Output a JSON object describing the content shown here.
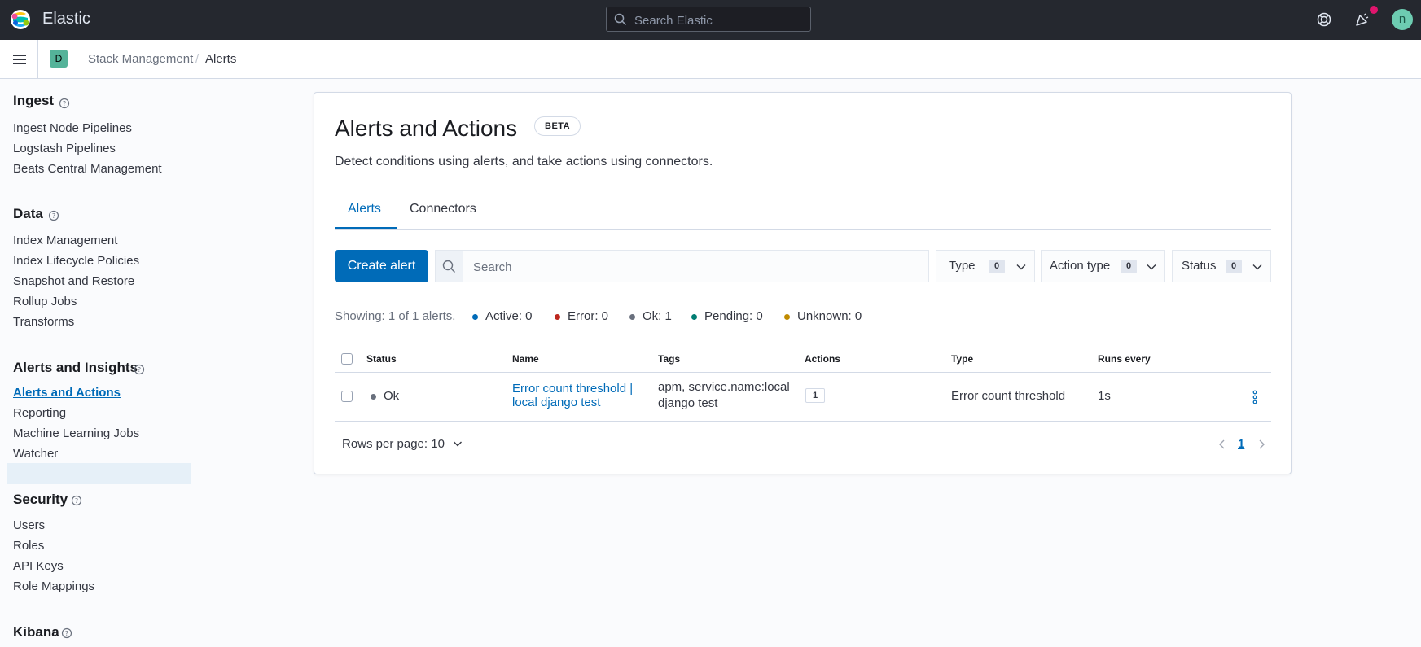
{
  "header": {
    "brand": "Elastic",
    "search_placeholder": "Search Elastic",
    "user_initial": "n"
  },
  "breadcrumbs": {
    "space_initial": "D",
    "items": [
      "Stack Management",
      "Alerts"
    ],
    "separator": "/"
  },
  "sidebar": {
    "sections": [
      {
        "title": "Ingest",
        "items": [
          "Ingest Node Pipelines",
          "Logstash Pipelines",
          "Beats Central Management"
        ]
      },
      {
        "title": "Data",
        "items": [
          "Index Management",
          "Index Lifecycle Policies",
          "Snapshot and Restore",
          "Rollup Jobs",
          "Transforms"
        ]
      },
      {
        "title": "Alerts and Insights",
        "items": [
          "Alerts and Actions",
          "Reporting",
          "Machine Learning Jobs",
          "Watcher"
        ],
        "active_index": 0
      },
      {
        "title": "Security",
        "items": [
          "Users",
          "Roles",
          "API Keys",
          "Role Mappings"
        ]
      },
      {
        "title": "Kibana",
        "items": []
      }
    ]
  },
  "main": {
    "title": "Alerts and Actions",
    "badge": "BETA",
    "description": "Detect conditions using alerts, and take actions using connectors.",
    "tabs": [
      {
        "label": "Alerts",
        "active": true
      },
      {
        "label": "Connectors",
        "active": false
      }
    ],
    "create_button": "Create alert",
    "search_placeholder": "Search",
    "filters": [
      {
        "label": "Type",
        "count": "0"
      },
      {
        "label": "Action type",
        "count": "0"
      },
      {
        "label": "Status",
        "count": "0"
      }
    ],
    "summary": "Showing: 1 of 1 alerts.",
    "stats": [
      {
        "label": "Active: 0",
        "color": "#006bb8"
      },
      {
        "label": "Error: 0",
        "color": "#bd271e"
      },
      {
        "label": "Ok: 1",
        "color": "#69707d"
      },
      {
        "label": "Pending: 0",
        "color": "#017d73"
      },
      {
        "label": "Unknown: 0",
        "color": "#c08b00"
      }
    ],
    "table": {
      "columns": [
        "Status",
        "Name",
        "Tags",
        "Actions",
        "Type",
        "Runs every"
      ],
      "rows": [
        {
          "status": "Ok",
          "name_line1": "Error count threshold |",
          "name_line2": "local django test",
          "tags_line1": "apm, service.name:local",
          "tags_line2": "django test",
          "actions": "1",
          "type": "Error count threshold",
          "runs_every": "1s"
        }
      ]
    },
    "pagination": {
      "rows_per_page": "Rows per page: 10",
      "current_page": "1"
    }
  },
  "colors": {
    "header_bg": "#25282f",
    "accent": "#006bb8",
    "notification": "#e0156d",
    "space_avatar": "#54b399",
    "user_avatar": "#6dccb1"
  }
}
